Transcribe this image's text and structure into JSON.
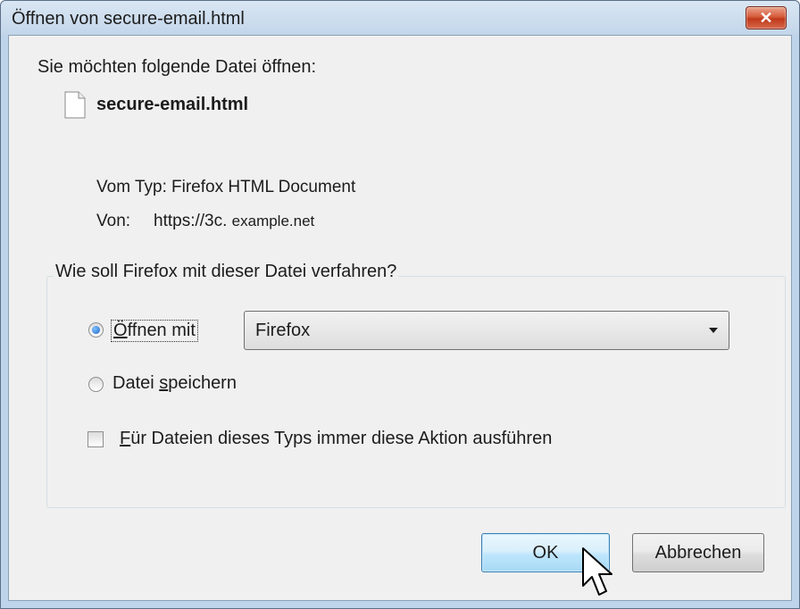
{
  "window": {
    "title": "Öffnen von secure-email.html",
    "close_label": "✕"
  },
  "dialog": {
    "prompt": "Sie möchten folgende Datei öffnen:",
    "file_name": "secure-email.html",
    "type_label": "Vom Typ:",
    "type_value": "Firefox HTML Document",
    "from_label": "Von:",
    "from_scheme": "https://3c.",
    "from_host": "example.net"
  },
  "action_group": {
    "title": "Wie soll Firefox mit dieser Datei verfahren?",
    "open_with": {
      "label_accel": "Ö",
      "label_rest": "ffnen mit",
      "checked": true
    },
    "open_with_app": "Firefox",
    "save_file": {
      "label_pre": "Datei ",
      "label_accel": "s",
      "label_rest": "peichern",
      "checked": false
    },
    "always": {
      "label_accel": "F",
      "label_rest": "ür Dateien dieses Typs immer diese Aktion ausführen",
      "checked": false
    }
  },
  "buttons": {
    "ok": "OK",
    "cancel": "Abbrechen"
  },
  "colors": {
    "frame": "#bed4ea",
    "close_button": "#c0391b",
    "default_button_border": "#3c7fb1"
  }
}
